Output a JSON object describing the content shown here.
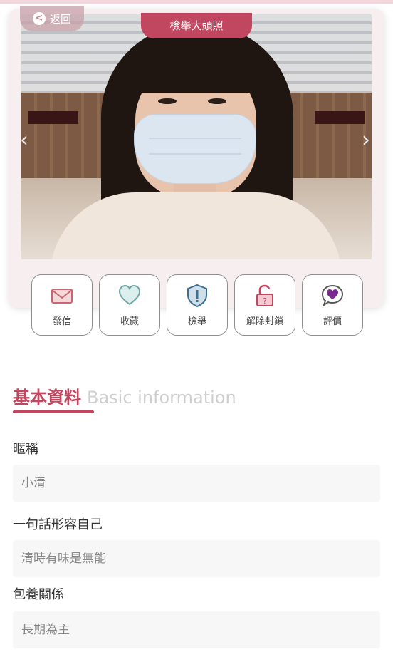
{
  "header": {
    "back_label": "返回",
    "back_icon": "chevron-left-icon",
    "photo_title": "檢舉大頭照"
  },
  "actions": [
    {
      "label": "發信",
      "icon": "mail-icon",
      "color": "#c9666f"
    },
    {
      "label": "收藏",
      "icon": "heart-icon",
      "color": "#6fa6a1"
    },
    {
      "label": "檢舉",
      "icon": "shield-alert-icon",
      "color": "#3e6f8f"
    },
    {
      "label": "解除封鎖",
      "icon": "unlock-icon",
      "color": "#c0475f"
    },
    {
      "label": "評價",
      "icon": "heart-chat-icon",
      "color": "#7a2a8f"
    }
  ],
  "section": {
    "title_zh": "基本資料",
    "title_en": "Basic information"
  },
  "fields": [
    {
      "label": "暱稱",
      "value": "小清"
    },
    {
      "label": "一句話形容自己",
      "value": "清時有味是無能"
    },
    {
      "label": "包養關係",
      "value": "長期為主"
    }
  ],
  "colors": {
    "accent": "#c0475f",
    "card_bg": "#f7eef0",
    "field_bg": "#f7f7f7"
  }
}
